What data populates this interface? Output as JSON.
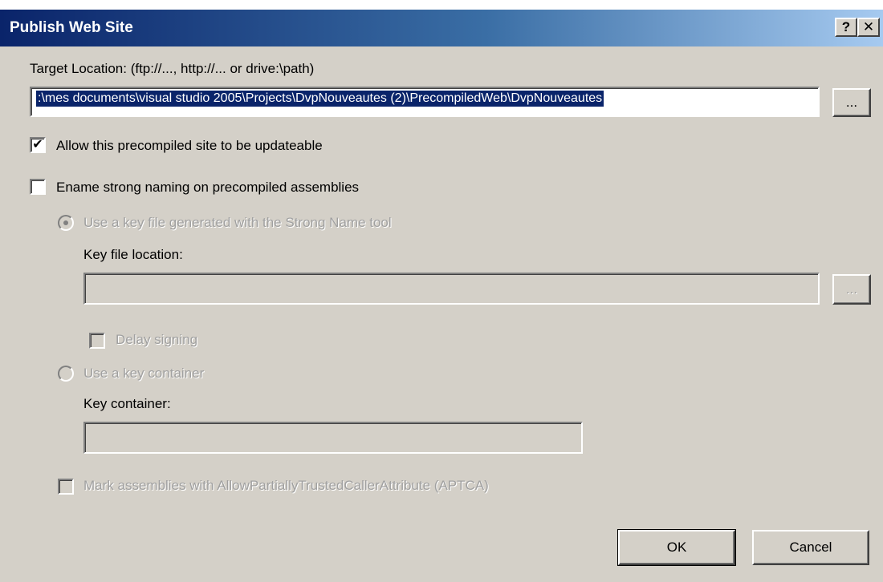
{
  "window": {
    "title": "Publish Web Site",
    "help_label": "?",
    "close_label": "✕"
  },
  "target": {
    "label": "Target Location: (ftp://..., http://... or drive:\\path)",
    "value": ":\\mes documents\\visual studio 2005\\Projects\\DvpNouveautes (2)\\PrecompiledWeb\\DvpNouveautes",
    "browse_label": "..."
  },
  "updateable": {
    "label": "Allow this precompiled site to be updateable",
    "checked_glyph": "✔"
  },
  "strong_naming": {
    "label": "Ename strong naming on precompiled assemblies"
  },
  "key_file_option": {
    "label": "Use a key file generated with the Strong Name tool"
  },
  "key_file_location": {
    "label": "Key file location:",
    "value": "",
    "browse_label": "..."
  },
  "delay_signing": {
    "label": "Delay signing"
  },
  "key_container_option": {
    "label": "Use a key container"
  },
  "key_container": {
    "label": "Key container:",
    "value": ""
  },
  "aptca": {
    "label": "Mark assemblies with AllowPartiallyTrustedCallerAttribute (APTCA)"
  },
  "buttons": {
    "ok": "OK",
    "cancel": "Cancel"
  },
  "colors": {
    "titlebar_start": "#0a246a",
    "titlebar_end": "#a6caf0",
    "dialog_bg": "#d4d0c8",
    "selection": "#0a246a"
  }
}
